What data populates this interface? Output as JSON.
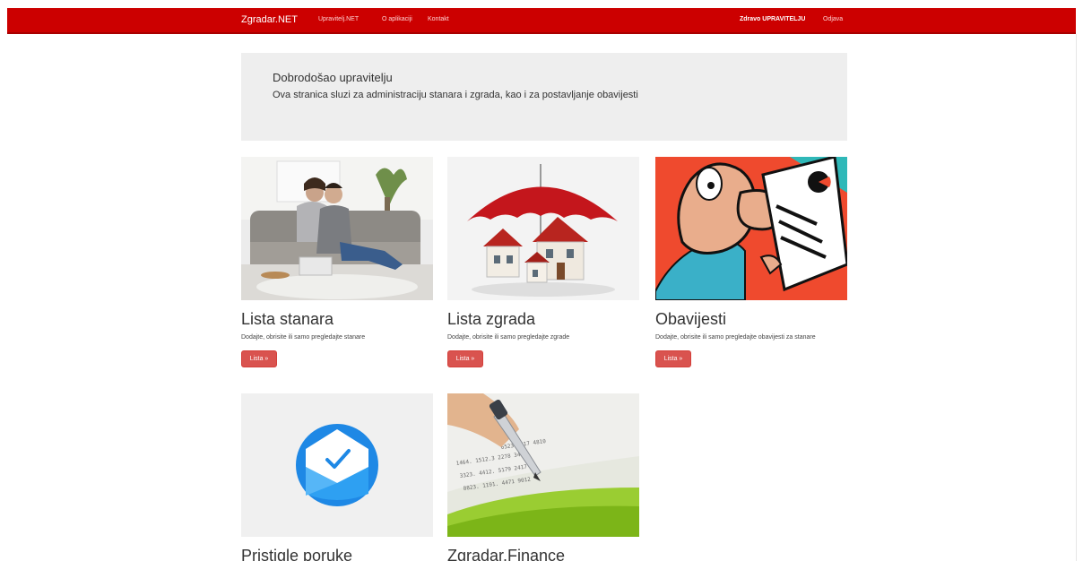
{
  "navbar": {
    "brand": "Zgradar.NET",
    "links": [
      "Upravitelj.NET",
      "O aplikaciji",
      "Kontakt"
    ],
    "user_greeting": "Zdravo UPRAVITELJU",
    "logout": "Odjava",
    "color": "#cc0000"
  },
  "jumbotron": {
    "title": "Dobrodošao upravitelju",
    "text": "Ova stranica sluzi za administraciju stanara i zgrada, kao i za postavljanje obavijesti"
  },
  "cards": [
    {
      "title": "Lista stanara",
      "description": "Dodajte, obrisite ili samo pregledajte stanare",
      "button": "Lista »"
    },
    {
      "title": "Lista zgrada",
      "description": "Dodajte, obrisite ili samo pregledajte zgrade",
      "button": "Lista »"
    },
    {
      "title": "Obavijesti",
      "description": "Dodajte, obrisite ili samo pregledajte obavijesti za stanare",
      "button": "Lista »"
    },
    {
      "title": "Pristigle poruke"
    },
    {
      "title": "Zgradar.Finance"
    }
  ],
  "button_color": "#d9534f"
}
